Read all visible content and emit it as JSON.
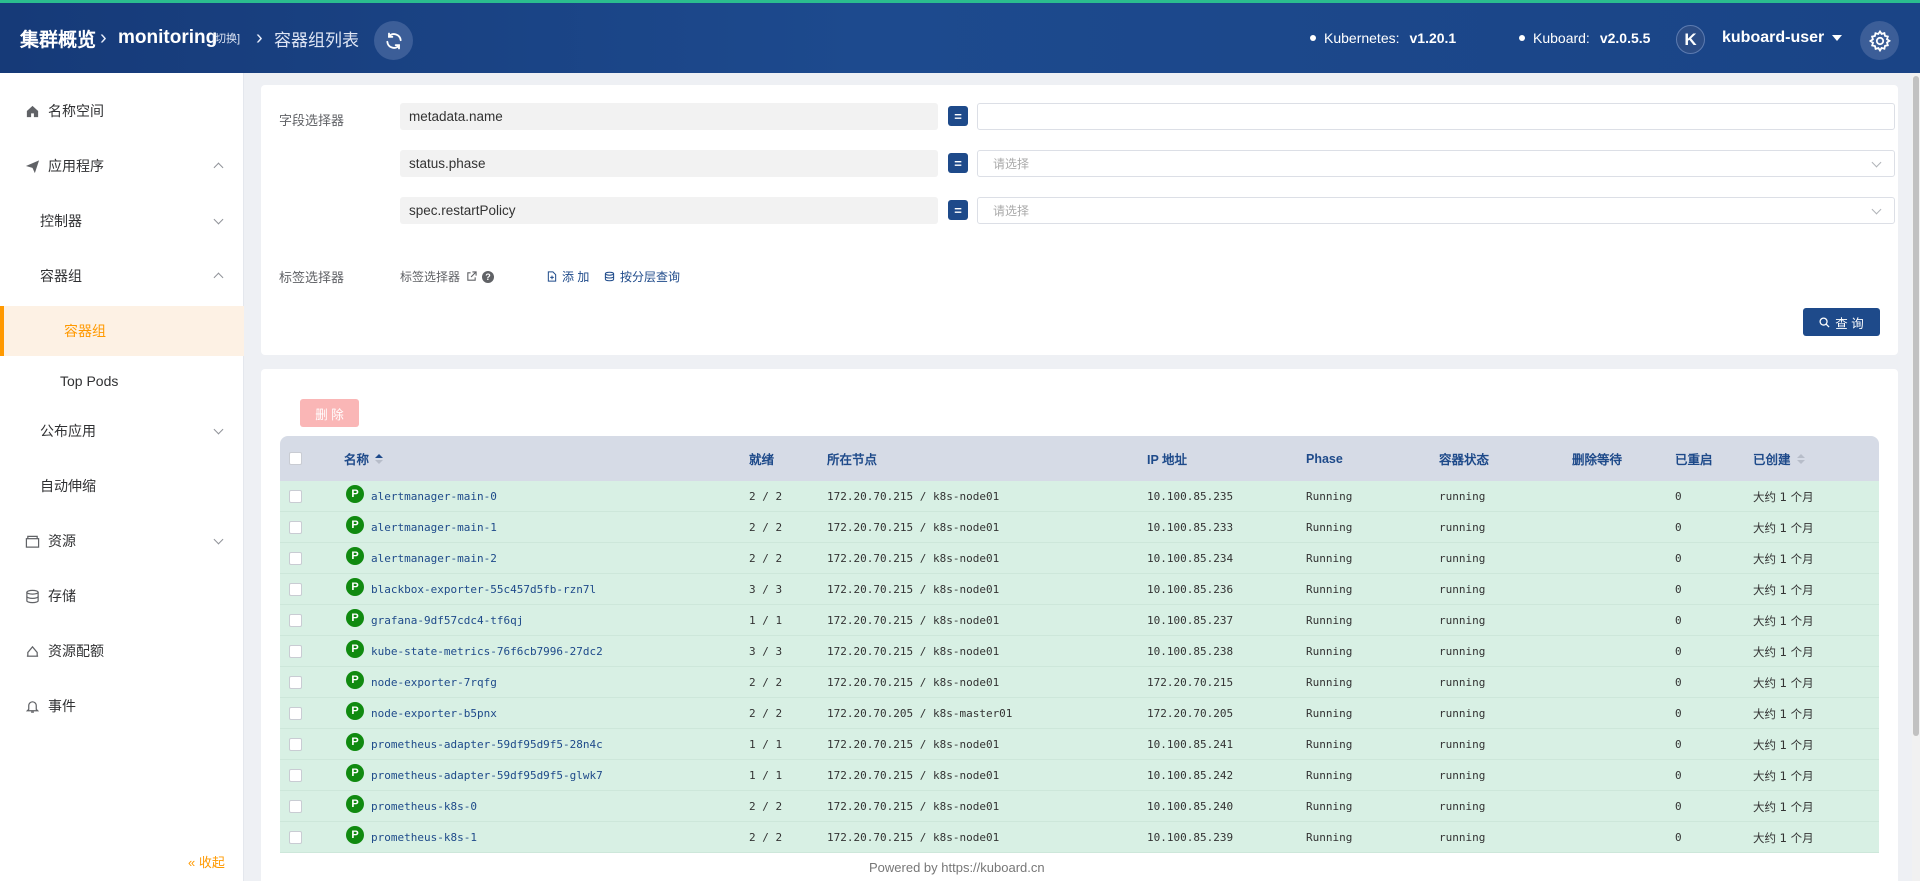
{
  "header": {
    "breadcrumb_root": "集群概览",
    "namespace": "monitoring",
    "switch_label": "[切换]",
    "page": "容器组列表",
    "k8s_label": "Kubernetes:",
    "k8s_version": "v1.20.1",
    "kuboard_label": "Kuboard:",
    "kuboard_version": "v2.0.5.5",
    "avatar_letter": "K",
    "username": "kuboard-user"
  },
  "sidebar": {
    "items": [
      {
        "label": "名称空间"
      },
      {
        "label": "应用程序"
      },
      {
        "label": "控制器"
      },
      {
        "label": "容器组"
      },
      {
        "label": "容器组"
      },
      {
        "label": "Top Pods"
      },
      {
        "label": "公布应用"
      },
      {
        "label": "自动伸缩"
      },
      {
        "label": "资源"
      },
      {
        "label": "存储"
      },
      {
        "label": "资源配额"
      },
      {
        "label": "事件"
      }
    ],
    "collapse": "« 收起"
  },
  "filters": {
    "field_selector_label": "字段选择器",
    "fields": [
      {
        "key": "metadata.name",
        "op": "=",
        "value": ""
      },
      {
        "key": "status.phase",
        "op": "=",
        "placeholder": "请选择"
      },
      {
        "key": "spec.restartPolicy",
        "op": "=",
        "placeholder": "请选择"
      }
    ],
    "label_selector_label": "标签选择器",
    "label_selector_link": "标签选择器",
    "help": "?",
    "add": "添 加",
    "layered_query": "按分层查询",
    "query_button": "查 询"
  },
  "table": {
    "delete_button": "删 除",
    "columns": [
      "名称",
      "就绪",
      "所在节点",
      "IP 地址",
      "Phase",
      "容器状态",
      "删除等待",
      "已重启",
      "已创建"
    ],
    "badge": "P",
    "rows": [
      {
        "name": "alertmanager-main-0",
        "ready": "2 / 2",
        "node": "172.20.70.215 / k8s-node01",
        "ip": "10.100.85.235",
        "phase": "Running",
        "status": "running",
        "wait": "",
        "restarts": "0",
        "created": "大约 1 个月"
      },
      {
        "name": "alertmanager-main-1",
        "ready": "2 / 2",
        "node": "172.20.70.215 / k8s-node01",
        "ip": "10.100.85.233",
        "phase": "Running",
        "status": "running",
        "wait": "",
        "restarts": "0",
        "created": "大约 1 个月"
      },
      {
        "name": "alertmanager-main-2",
        "ready": "2 / 2",
        "node": "172.20.70.215 / k8s-node01",
        "ip": "10.100.85.234",
        "phase": "Running",
        "status": "running",
        "wait": "",
        "restarts": "0",
        "created": "大约 1 个月"
      },
      {
        "name": "blackbox-exporter-55c457d5fb-rzn7l",
        "ready": "3 / 3",
        "node": "172.20.70.215 / k8s-node01",
        "ip": "10.100.85.236",
        "phase": "Running",
        "status": "running",
        "wait": "",
        "restarts": "0",
        "created": "大约 1 个月"
      },
      {
        "name": "grafana-9df57cdc4-tf6qj",
        "ready": "1 / 1",
        "node": "172.20.70.215 / k8s-node01",
        "ip": "10.100.85.237",
        "phase": "Running",
        "status": "running",
        "wait": "",
        "restarts": "0",
        "created": "大约 1 个月"
      },
      {
        "name": "kube-state-metrics-76f6cb7996-27dc2",
        "ready": "3 / 3",
        "node": "172.20.70.215 / k8s-node01",
        "ip": "10.100.85.238",
        "phase": "Running",
        "status": "running",
        "wait": "",
        "restarts": "0",
        "created": "大约 1 个月"
      },
      {
        "name": "node-exporter-7rqfg",
        "ready": "2 / 2",
        "node": "172.20.70.215 / k8s-node01",
        "ip": "172.20.70.215",
        "phase": "Running",
        "status": "running",
        "wait": "",
        "restarts": "0",
        "created": "大约 1 个月"
      },
      {
        "name": "node-exporter-b5pnx",
        "ready": "2 / 2",
        "node": "172.20.70.205 / k8s-master01",
        "ip": "172.20.70.205",
        "phase": "Running",
        "status": "running",
        "wait": "",
        "restarts": "0",
        "created": "大约 1 个月"
      },
      {
        "name": "prometheus-adapter-59df95d9f5-28n4c",
        "ready": "1 / 1",
        "node": "172.20.70.215 / k8s-node01",
        "ip": "10.100.85.241",
        "phase": "Running",
        "status": "running",
        "wait": "",
        "restarts": "0",
        "created": "大约 1 个月"
      },
      {
        "name": "prometheus-adapter-59df95d9f5-glwk7",
        "ready": "1 / 1",
        "node": "172.20.70.215 / k8s-node01",
        "ip": "10.100.85.242",
        "phase": "Running",
        "status": "running",
        "wait": "",
        "restarts": "0",
        "created": "大约 1 个月"
      },
      {
        "name": "prometheus-k8s-0",
        "ready": "2 / 2",
        "node": "172.20.70.215 / k8s-node01",
        "ip": "10.100.85.240",
        "phase": "Running",
        "status": "running",
        "wait": "",
        "restarts": "0",
        "created": "大约 1 个月"
      },
      {
        "name": "prometheus-k8s-1",
        "ready": "2 / 2",
        "node": "172.20.70.215 / k8s-node01",
        "ip": "10.100.85.239",
        "phase": "Running",
        "status": "running",
        "wait": "",
        "restarts": "0",
        "created": "大约 1 个月"
      }
    ]
  },
  "footer": "Powered by https://kuboard.cn",
  "colors": {
    "header": "#1d4a8e",
    "accent": "#ff9900",
    "primary": "#1e4a8a",
    "row_bg": "#d8f0e4",
    "badge": "#108a10"
  }
}
